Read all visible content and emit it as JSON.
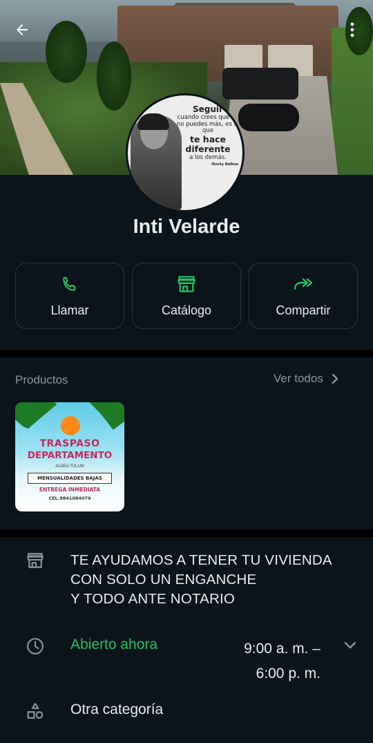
{
  "profile": {
    "name": "Inti Velarde",
    "avatar_quote": {
      "line1": "Seguir",
      "line2": "cuando crees que ya no puedes más, es lo que",
      "line3": "te hace diferente",
      "line4": "a los demás.",
      "author": "-Rocky Balboa"
    }
  },
  "actions": [
    {
      "label": "Llamar",
      "icon": "phone-icon"
    },
    {
      "label": "Catálogo",
      "icon": "storefront-icon"
    },
    {
      "label": "Compartir",
      "icon": "forward-icon"
    }
  ],
  "products": {
    "title": "Productos",
    "see_all": "Ver todos",
    "items": [
      {
        "line1": "TRASPASO",
        "line2": "DEPARTAMENTO",
        "line3": "ALDEA TULUM",
        "line4": "MENSUALIDADES BAJAS",
        "line5": "ENTREGA INMEDIATA",
        "line6": "CEL.9841084079"
      }
    ]
  },
  "business": {
    "description": [
      "TE AYUDAMOS A TENER TU VIVIENDA",
      "CON SOLO UN ENGANCHE",
      "Y TODO ANTE NOTARIO"
    ],
    "status": "Abierto ahora",
    "hours_open": "9:00 a. m. –",
    "hours_close": "6:00 p. m.",
    "category": "Otra categoría"
  },
  "colors": {
    "background": "#0b141a",
    "accent_green": "#21c063",
    "muted_text": "#8696a0",
    "card_border": "#2a3942"
  }
}
